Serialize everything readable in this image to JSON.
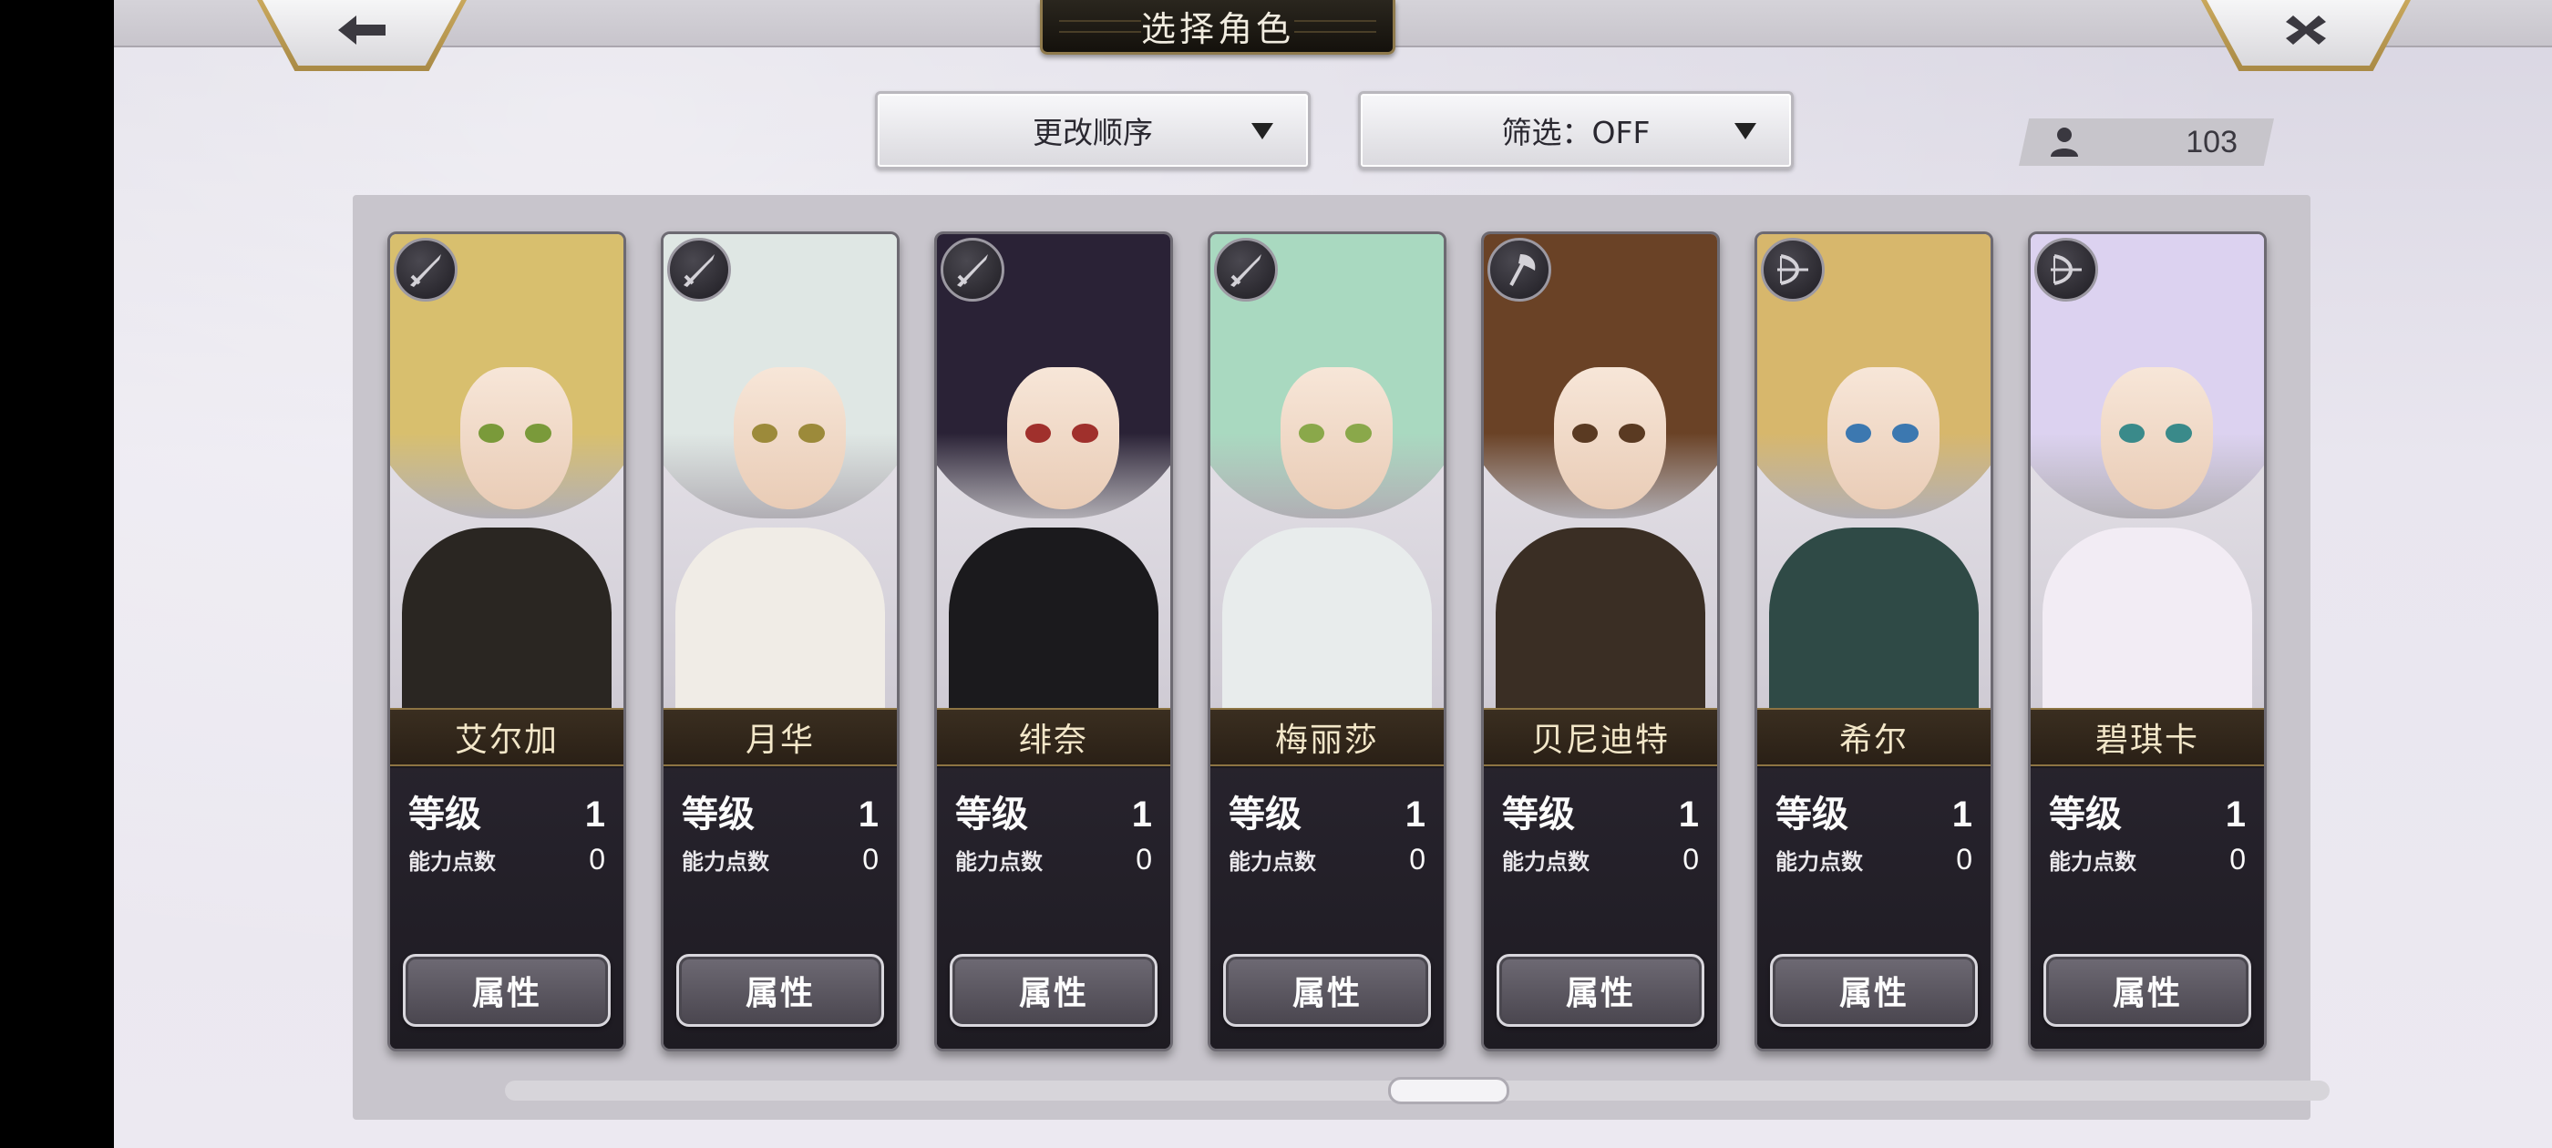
{
  "header": {
    "title": "选择角色",
    "back_icon": "arrow-left-icon",
    "close_icon": "close-icon"
  },
  "toolbar": {
    "sort_label": "更改顺序",
    "filter_label": "筛选：OFF",
    "character_count": "103",
    "count_icon": "person-icon"
  },
  "characters": [
    {
      "name": "艾尔加",
      "level_label": "等级",
      "level": "1",
      "points_label": "能力点数",
      "points": "0",
      "button": "属性",
      "class_icon": "sword-icon",
      "hair": "#d8bf6e",
      "eye": "#7a9a3a",
      "body": "#2a2622"
    },
    {
      "name": "月华",
      "level_label": "等级",
      "level": "1",
      "points_label": "能力点数",
      "points": "0",
      "button": "属性",
      "class_icon": "sword-icon",
      "hair": "#dfe7e4",
      "eye": "#9c8a3a",
      "body": "#f0ece6"
    },
    {
      "name": "绯奈",
      "level_label": "等级",
      "level": "1",
      "points_label": "能力点数",
      "points": "0",
      "button": "属性",
      "class_icon": "sword-icon",
      "hair": "#2a2236",
      "eye": "#a0302c",
      "body": "#1b1a1d"
    },
    {
      "name": "梅丽莎",
      "level_label": "等级",
      "level": "1",
      "points_label": "能力点数",
      "points": "0",
      "button": "属性",
      "class_icon": "sword-icon",
      "hair": "#a9d9c0",
      "eye": "#8aa84a",
      "body": "#e8ecec"
    },
    {
      "name": "贝尼迪特",
      "level_label": "等级",
      "level": "1",
      "points_label": "能力点数",
      "points": "0",
      "button": "属性",
      "class_icon": "axe-icon",
      "hair": "#6a4226",
      "eye": "#5a3a22",
      "body": "#3a2e24"
    },
    {
      "name": "希尔",
      "level_label": "等级",
      "level": "1",
      "points_label": "能力点数",
      "points": "0",
      "button": "属性",
      "class_icon": "bow-icon",
      "hair": "#d7b76c",
      "eye": "#3c78b0",
      "body": "#2f4a46"
    },
    {
      "name": "碧琪卡",
      "level_label": "等级",
      "level": "1",
      "points_label": "能力点数",
      "points": "0",
      "button": "属性",
      "class_icon": "bow-icon",
      "hair": "#dcd2f0",
      "eye": "#3a8a8a",
      "body": "#f2ecf4"
    }
  ]
}
